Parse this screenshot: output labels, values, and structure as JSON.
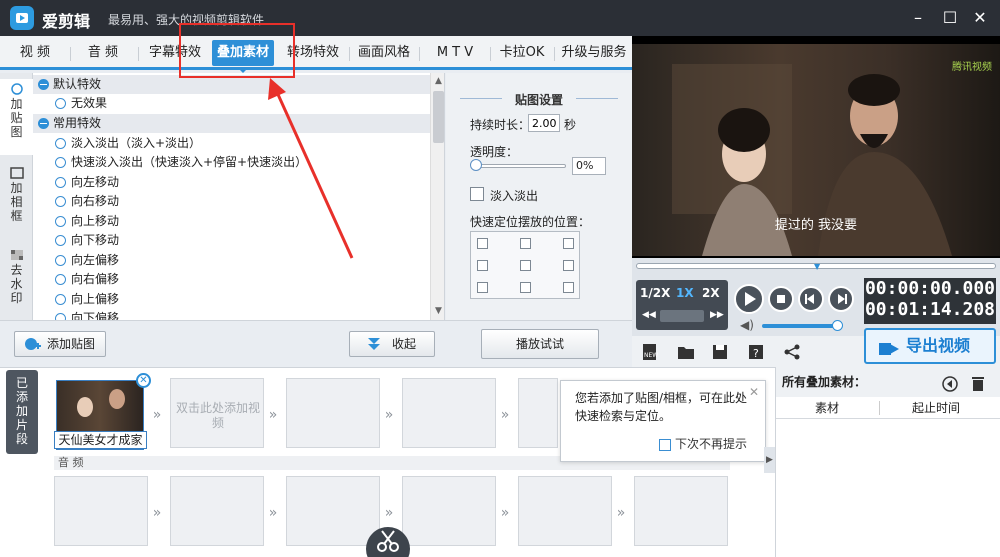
{
  "app": {
    "title": "爱剪辑",
    "slogan": "最易用、强大的视频剪辑软件"
  },
  "window_controls": {
    "minimize": "–",
    "maximize": "☐",
    "close": "✕"
  },
  "main_tabs": [
    {
      "label": "视  频"
    },
    {
      "label": "音  频"
    },
    {
      "label": "字幕特效"
    },
    {
      "label": "叠加素材",
      "active": true
    },
    {
      "label": "转场特效"
    },
    {
      "label": "画面风格"
    },
    {
      "label": "M T V"
    },
    {
      "label": "卡拉OK"
    },
    {
      "label": "升级与服务"
    }
  ],
  "side_tabs": [
    {
      "label": "加贴图"
    },
    {
      "label": "加相框"
    },
    {
      "label": "去水印"
    }
  ],
  "effects": {
    "groups": [
      {
        "label": "默认特效",
        "items": [
          "无效果"
        ]
      },
      {
        "label": "常用特效",
        "items": [
          "淡入淡出（淡入+淡出）",
          "快速淡入淡出（快速淡入+停留+快速淡出）",
          "向左移动",
          "向右移动",
          "向上移动",
          "向下移动",
          "向左偏移",
          "向右偏移",
          "向上偏移",
          "向下偏移"
        ]
      }
    ]
  },
  "sticker_settings": {
    "title": "贴图设置",
    "duration_label": "持续时长：",
    "duration_value": "2.00",
    "duration_unit": "秒",
    "opacity_label": "透明度：",
    "opacity_value": "0%",
    "opacity_level": 0,
    "fade_label": "淡入淡出",
    "position_label": "快速定位摆放的位置：",
    "preview_button": "播放试试"
  },
  "toolbar": {
    "add_sticker": "添加贴图",
    "collapse": "收起"
  },
  "preview": {
    "subtitle": "提过的 我没要",
    "watermark": "腾讯视频",
    "speeds": [
      "1/2X",
      "1X",
      "2X"
    ],
    "active_speed": "1X",
    "current_time": "00:00:00.000",
    "total_time": "00:01:14.208",
    "volume_level": 0.9,
    "export_label": "导出视频"
  },
  "timeline": {
    "added_tab": "已添加片段",
    "clip_label": "天仙美女才成家",
    "empty_slot_text": "双击此处添加视频",
    "audio_label": "音  频"
  },
  "tooltip": {
    "text": "您若添加了贴图/相框，可在此处快速检索与定位。",
    "checkbox_label": "下次不再提示",
    "close": "✕"
  },
  "side_panel": {
    "title": "所有叠加素材：",
    "col_material": "素材",
    "col_start": "起止时间"
  },
  "colors": {
    "accent": "#2d8fd7",
    "highlight": "#e8302a",
    "titlebar": "#2b2f36"
  }
}
